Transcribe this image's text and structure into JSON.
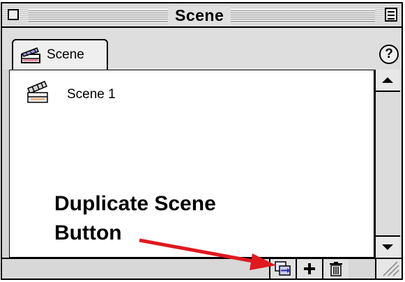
{
  "window": {
    "title": "Scene"
  },
  "tabs": [
    {
      "label": "Scene",
      "icon": "scene-panel-icon"
    }
  ],
  "help": {
    "label": "?"
  },
  "scenes": [
    {
      "label": "Scene 1",
      "icon": "clapperboard-icon"
    }
  ],
  "toolbar": {
    "buttons": [
      {
        "name": "duplicate-scene",
        "icon": "duplicate-icon"
      },
      {
        "name": "add-scene",
        "icon": "plus-icon"
      },
      {
        "name": "delete-scene",
        "icon": "trash-icon"
      }
    ]
  },
  "annotation": {
    "line1": "Duplicate Scene",
    "line2": "Button",
    "color": "#e0191f"
  }
}
